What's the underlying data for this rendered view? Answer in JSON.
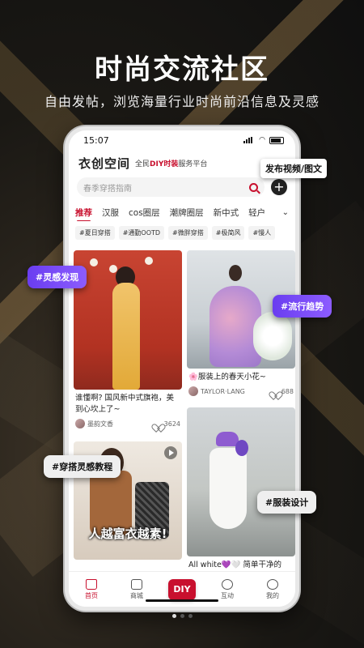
{
  "promo": {
    "headline": "时尚交流社区",
    "subline": "自由发帖，浏览海量行业时尚前沿信息及灵感"
  },
  "status_bar": {
    "time": "15:07"
  },
  "app": {
    "logo": "衣创空间",
    "slogan_prefix": "全民",
    "slogan_diy": "DIY时装",
    "slogan_suffix": "服务平台",
    "accent_color": "#c8102e"
  },
  "search": {
    "placeholder": "春季穿搭指南"
  },
  "tabs": [
    {
      "label": "推荐",
      "active": true
    },
    {
      "label": "汉服"
    },
    {
      "label": "cos圈层"
    },
    {
      "label": "潮牌圈层"
    },
    {
      "label": "新中式"
    },
    {
      "label": "轻户"
    }
  ],
  "tabs_more_icon": "chevron-down-icon",
  "chips": [
    "#夏日穿搭",
    "#通勤OOTD",
    "#微胖穿搭",
    "#极简风",
    "#慢人"
  ],
  "posts": [
    {
      "title": "谁懂啊? 国风新中式旗袍，美到心坎上了~",
      "author": "墨韵文香",
      "likes": "3624"
    },
    {
      "title": "🌸服装上的春天小花~",
      "author": "TAYLOR·LANG",
      "likes": "688"
    },
    {
      "caption": "人越富衣越素!",
      "is_video": true
    },
    {
      "title": "All white💜🤍 简单干净的"
    }
  ],
  "bottom_nav": [
    {
      "label": "首页",
      "icon": "home-icon",
      "active": true
    },
    {
      "label": "商城",
      "icon": "shop-icon"
    },
    {
      "label": "DIY",
      "icon": "diy-icon",
      "center": true
    },
    {
      "label": "互动",
      "icon": "message-icon"
    },
    {
      "label": "我的",
      "icon": "profile-icon"
    }
  ],
  "callouts": {
    "publish": "发布视频/图文",
    "tag_inspiration": "#灵感发现",
    "tag_trend": "#流行趋势",
    "tag_tutorial": "#穿搭灵感教程",
    "tag_design": "#服装设计"
  },
  "pager": {
    "count": 3,
    "current": 1
  }
}
